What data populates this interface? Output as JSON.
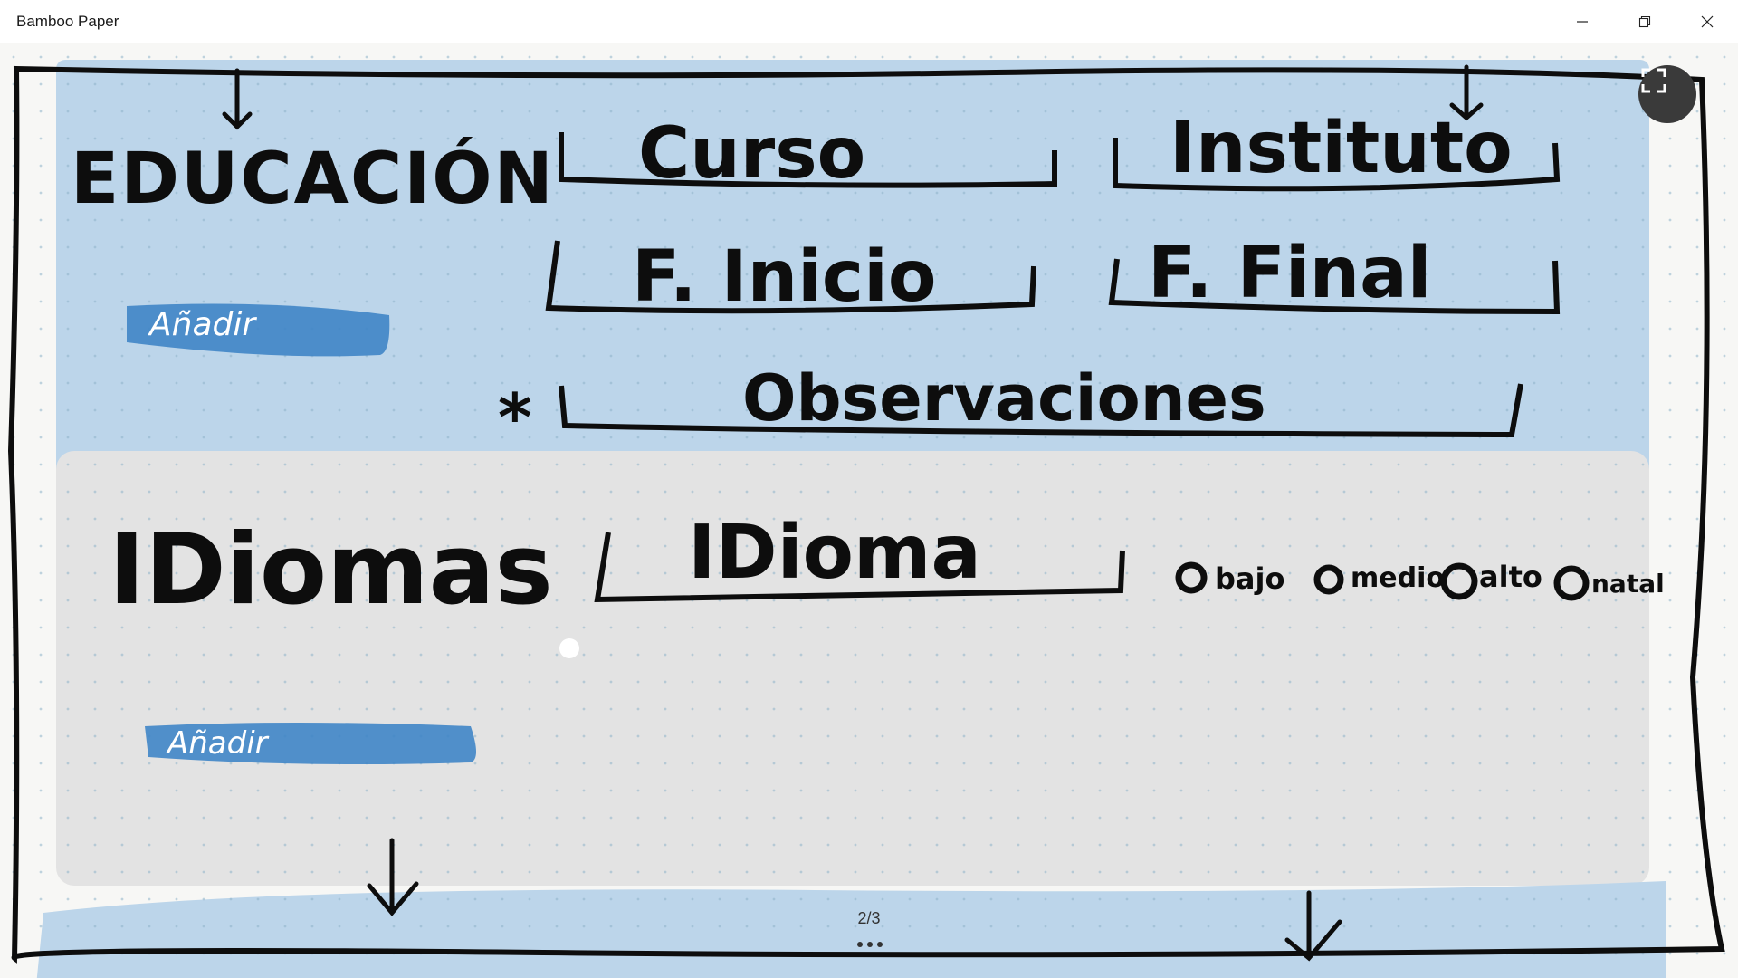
{
  "window": {
    "title": "Bamboo Paper",
    "minimize_icon": "minimize-icon",
    "restore_icon": "restore-icon",
    "close_icon": "close-icon"
  },
  "sketch": {
    "education": {
      "heading": "EDUCACIÓN",
      "fields": {
        "curso": "Curso",
        "instituto": "Instituto",
        "fecha_inicio": "F. Inicio",
        "fecha_final": "F. Final",
        "observaciones": "Observaciones"
      },
      "required_mark": "*",
      "add_button": "Añadir"
    },
    "languages": {
      "heading": "IDiomas",
      "fields": {
        "idioma": "IDioma"
      },
      "levels": [
        "bajo",
        "medio",
        "alto",
        "natal"
      ],
      "add_button": "Añadir"
    }
  },
  "colors": {
    "education_band": "#bcd5ea",
    "languages_band": "#e3e3e3",
    "button_fill": "#3f85c7",
    "ink": "#0d0d0d"
  },
  "pagination": {
    "label": "2/3"
  },
  "toolbar": {
    "fullscreen_icon": "fullscreen-icon"
  }
}
